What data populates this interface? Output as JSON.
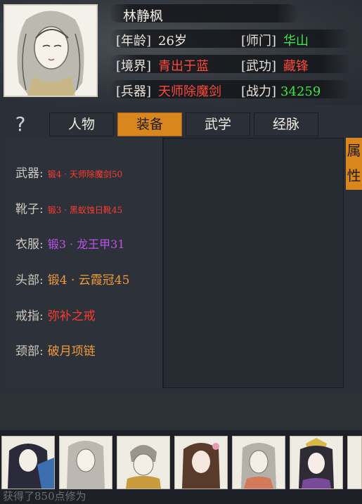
{
  "character": {
    "name": "林静枫",
    "age_label": "[年龄]",
    "age_value": "26岁",
    "sect_label": "[师门]",
    "sect_value": "华山",
    "realm_label": "[境界]",
    "realm_value": "青出于蓝",
    "skill_label": "[武功]",
    "skill_value": "藏锋",
    "weapon_label": "[兵器]",
    "weapon_value": "天师除魔剑",
    "power_label": "[战力]",
    "power_value": "34259"
  },
  "help_icon": "?",
  "tabs": [
    {
      "label": "人物",
      "active": false
    },
    {
      "label": "装备",
      "active": true
    },
    {
      "label": "武学",
      "active": false
    },
    {
      "label": "经脉",
      "active": false
    }
  ],
  "side_tab_label": "属性",
  "equipment": [
    {
      "slot": "武器:",
      "item": "锻4 · 天师除魔剑50"
    },
    {
      "slot": "靴子:",
      "item": "锻3 · 黑蚁蚀日靴45"
    },
    {
      "slot": "衣服:",
      "item": "锻3 · 龙王甲31"
    },
    {
      "slot": "头部:",
      "item": "锻4 · 云霞冠45"
    },
    {
      "slot": "戒指:",
      "item": "弥补之戒"
    },
    {
      "slot": "颈部:",
      "item": "破月项链"
    }
  ],
  "toast": "获得了850点修为",
  "colors": {
    "accent_tab": "#d9861e",
    "red": "#ff3b2f",
    "green": "#3ee64a",
    "purple": "#c052f0",
    "orange": "#f09a3a"
  }
}
